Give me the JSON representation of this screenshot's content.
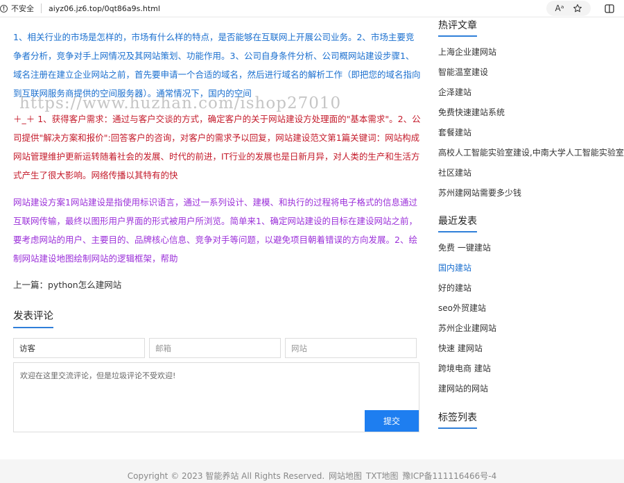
{
  "browser": {
    "insecure_label": "不安全",
    "url": "aiyz06.jz6.top/0qt86a9s.html",
    "read_aloud_glyph": "Aᵃ",
    "icons": [
      "warning-icon",
      "read-aloud-icon",
      "favorite-star-icon",
      "split-screen-icon"
    ]
  },
  "watermark": "https://www.huzhan.com/ishop27010",
  "article": {
    "paragraph_blue": "1、相关行业的市场是怎样的，市场有什么样的特点，是否能够在互联网上开展公司业务。2、市场主要竞争者分析，竞争对手上网情况及其网站策划、功能作用。3、公司自身条件分析、公司概网站建设步骤1、域名注册在建立企业网站之前，首先要申请一个合适的域名，然后进行域名的解析工作（即把您的域名指向到互联网服务商提供的空间服务器）。通常情况下，国内的空间",
    "paragraph_red": "＋_＋ 1、获得客户需求：通过与客户交谈的方式，确定客户的关于网站建设方处理面的\"基本需求\"。2、公司提供\"解决方案和报价\":回答客户的咨询，对客户的需求予以回复，网站建设范文第1篇关键词：网站构成网站管理维护更新运转随着社会的发展、时代的前进，IT行业的发展也是日新月异，对人类的生产和生活方式产生了很大影响。网络传播以其特有的快",
    "paragraph_purple": "网站建设方案1网站建设是指使用标识语言，通过一系列设计、建模、和执行的过程将电子格式的信息通过互联网传输，最终以图形用户界面的形式被用户所浏览。简单来1、确定网站建设的目标在建设网站之前，要考虑网站的用户、主要目的、品牌核心信息、竞争对手等问题，以避免项目朝着错误的方向发展。2、绘制网站建设地图绘制网站的逻辑框架，帮助",
    "prev_post": "上一篇：python怎么建网站"
  },
  "comment_form": {
    "title": "发表评论",
    "name_value": "访客",
    "email_placeholder": "邮箱",
    "website_placeholder": "网站",
    "textarea_placeholder": "欢迎在这里交流评论，但是垃圾评论不受欢迎!",
    "submit_label": "提交"
  },
  "sidebar": {
    "hot_title": "热评文章",
    "hot_items": [
      "上海企业建网站",
      "智能温室建设",
      "企泽建站",
      "免费快速建站系统",
      "套餐建站",
      "高校人工智能实验室建设,中南大学人工智能实验室",
      "社区建站",
      "苏州建网站需要多少钱"
    ],
    "recent_title": "最近发表",
    "recent_items": [
      "免费 一键建站",
      "国内建站",
      "好的建站",
      "seo外贸建站",
      "苏州企业建网站",
      "快速 建网站",
      "跨境电商 建站",
      "建网站的网站"
    ],
    "recent_active_index": 1,
    "tags_title": "标签列表"
  },
  "footer": {
    "copyright": "Copyright © 2023 智能养站 All Rights Reserved.",
    "sitemap": "网站地图",
    "txt_map": "TXT地图",
    "icp": "豫ICP备111116466号-4"
  },
  "colors": {
    "link_blue": "#1a6fcf",
    "text_red": "#c41a2a",
    "text_purple": "#9b30d9",
    "accent_underline": "#2f7fd9",
    "submit_bg": "#1e7ef0"
  }
}
